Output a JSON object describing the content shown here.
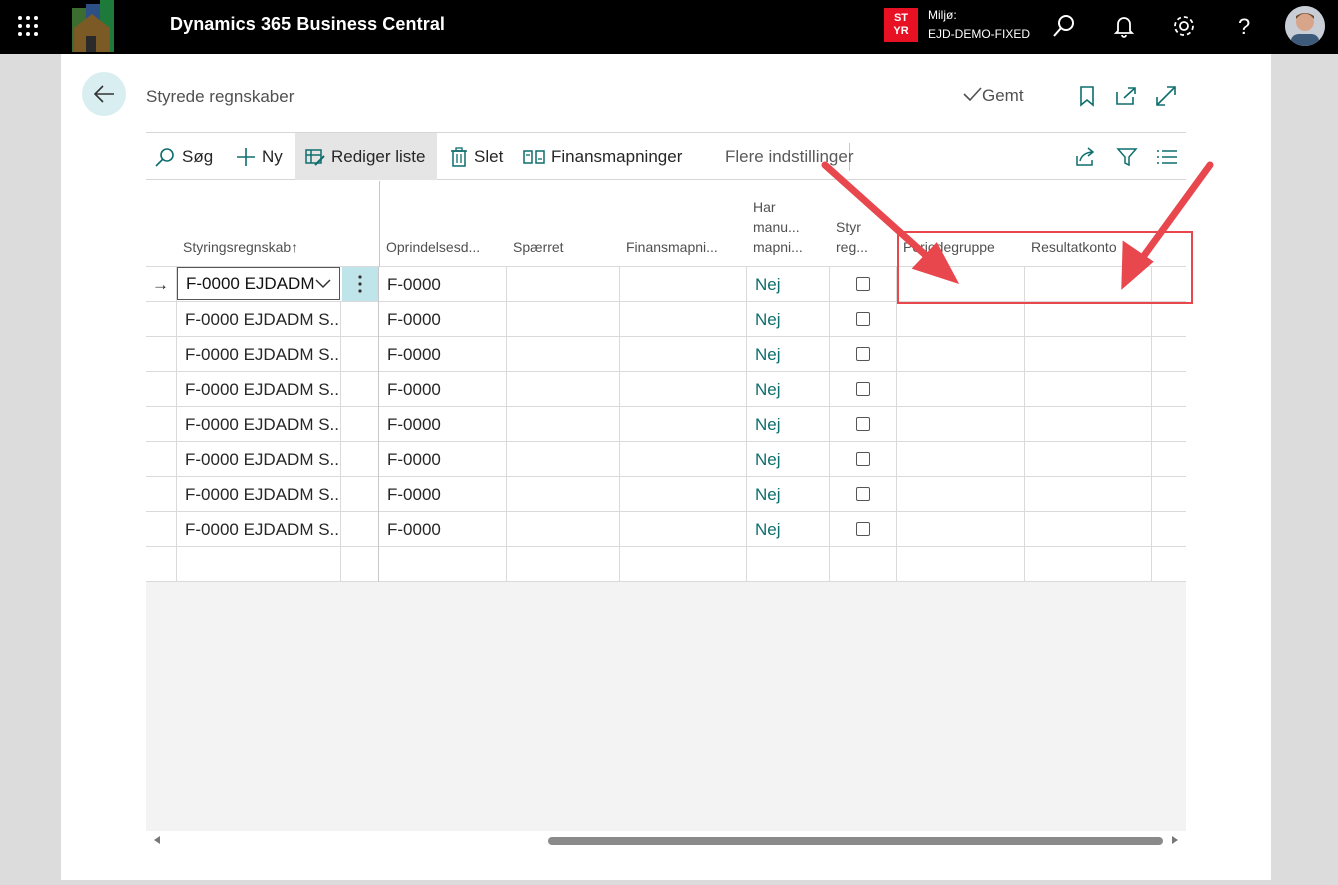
{
  "topbar": {
    "app_title": "Dynamics 365 Business Central",
    "env_badge": "ST YR",
    "env_label": "Miljø:",
    "env_name": "EJD-DEMO-FIXED",
    "icons": [
      "waffle-icon",
      "search-icon",
      "bell-icon",
      "gear-icon",
      "help-icon"
    ]
  },
  "header": {
    "page_title": "Styrede regnskaber",
    "saved_label": "Gemt"
  },
  "actions": {
    "search": "Søg",
    "new": "Ny",
    "edit_list": "Rediger liste",
    "delete": "Slet",
    "mappings": "Finansmapninger",
    "more": "Flere indstillinger"
  },
  "columns": {
    "c1": "Styringsregnskab",
    "c1_sort": "↑",
    "c2": "Oprindelsesd...",
    "c3": "Spærret",
    "c4": "Finansmapni...",
    "c5_l1": "Har",
    "c5_l2": "manu...",
    "c5_l3": "mapni...",
    "c6_l1": "Styr",
    "c6_l2": "reg...",
    "c7": "Periodegruppe",
    "c8": "Resultatkonto"
  },
  "current_row": {
    "account": "F-0000 EJDADM",
    "origin": "F-0000",
    "manual": "Nej"
  },
  "rows": [
    {
      "account": "F-0000 EJDADM S...",
      "origin": "F-0000",
      "manual": "Nej"
    },
    {
      "account": "F-0000 EJDADM S...",
      "origin": "F-0000",
      "manual": "Nej"
    },
    {
      "account": "F-0000 EJDADM S...",
      "origin": "F-0000",
      "manual": "Nej"
    },
    {
      "account": "F-0000 EJDADM S...",
      "origin": "F-0000",
      "manual": "Nej"
    },
    {
      "account": "F-0000 EJDADM S...",
      "origin": "F-0000",
      "manual": "Nej"
    },
    {
      "account": "F-0000 EJDADM S...",
      "origin": "F-0000",
      "manual": "Nej"
    },
    {
      "account": "F-0000 EJDADM S...",
      "origin": "F-0000",
      "manual": "Nej"
    }
  ],
  "colors": {
    "accent": "#0e6e6e",
    "highlight": "#e8474d",
    "badge": "#e81123"
  }
}
